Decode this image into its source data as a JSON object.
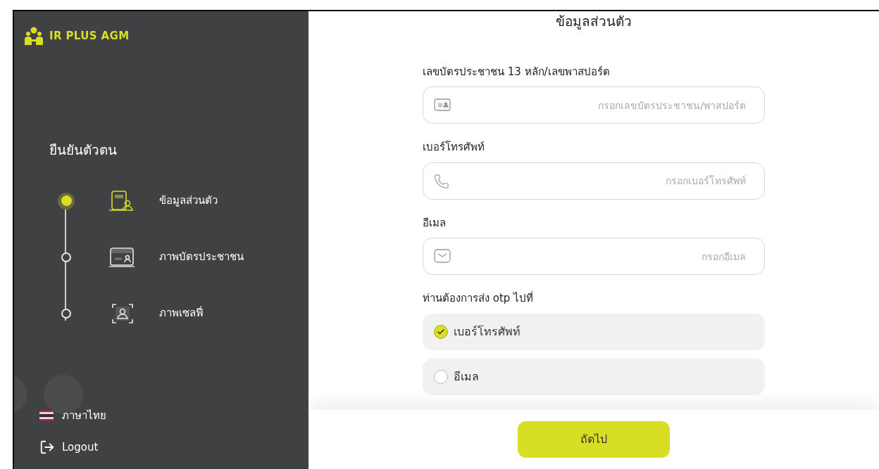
{
  "brand": {
    "name": "IR PLUS AGM"
  },
  "sidebar": {
    "heading": "ยืนยันตัวตน",
    "steps": [
      {
        "label": "ข้อมูลส่วนตัว",
        "kind": "info",
        "selected": true
      },
      {
        "label": "ภาพบัตรประชาชน",
        "kind": "card",
        "selected": false
      },
      {
        "label": "ภาพเซลฟี่",
        "kind": "selfie",
        "selected": false
      }
    ],
    "language": "ภาษาไทย",
    "logout": "Logout"
  },
  "form": {
    "title": "ข้อมูลส่วนตัว",
    "fields": [
      {
        "label": "เลขบัตรประชาชน 13 หลัก/เลขพาสปอร์ต",
        "placeholder": "กรอกเลขบัตรประชาชน/พาสปอร์ต",
        "kind": "id"
      },
      {
        "label": "เบอร์โทรศัพท์",
        "placeholder": "กรอกเบอร์โทรศัพท์",
        "kind": "phone"
      },
      {
        "label": "อีเมล",
        "placeholder": "กรอกอีเมล",
        "kind": "email"
      }
    ],
    "otp": {
      "label": "ท่านต้องการส่ง otp ไปที่",
      "options": [
        {
          "label": "เบอร์โทรศัพท์",
          "selected": true
        },
        {
          "label": "อีเมล",
          "selected": false
        }
      ]
    },
    "next_button": "ถัดไป"
  }
}
